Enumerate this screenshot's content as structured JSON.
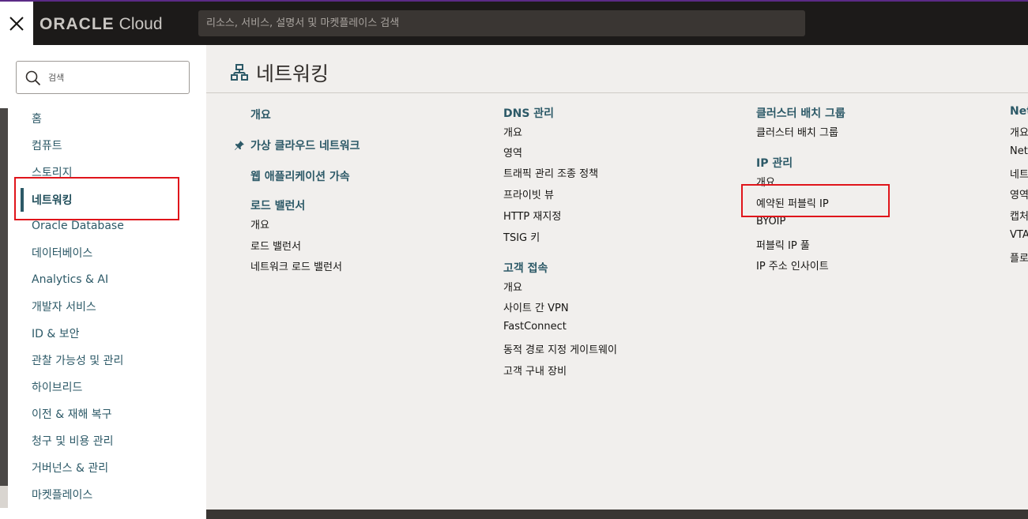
{
  "header": {
    "brand_oracle": "ORACLE",
    "brand_cloud": "Cloud",
    "search_placeholder": "리소스, 서비스, 설명서 및 마켓플레이스 검색"
  },
  "sidebar": {
    "search_placeholder": "검색",
    "items": [
      "홈",
      "컴퓨트",
      "스토리지",
      "네트워킹",
      "Oracle Database",
      "데이터베이스",
      "Analytics & AI",
      "개발자 서비스",
      "ID & 보안",
      "관찰 가능성 및 관리",
      "하이브리드",
      "이전 & 재해 복구",
      "청구 및 비용 관리",
      "거버넌스 & 관리",
      "마켓플레이스"
    ],
    "active_item": "네트워킹"
  },
  "main": {
    "title": "네트워킹",
    "col1": {
      "overview": "개요",
      "vcn": "가상 클라우드 네트워크",
      "waa": "웹 애플리케이션 가속",
      "lb_heading": "로드 밸런서",
      "lb_links": [
        "개요",
        "로드 밸런서",
        "네트워크 로드 밸런서"
      ]
    },
    "col2": {
      "dns_heading": "DNS 관리",
      "dns_links": [
        "개요",
        "영역",
        "트래픽 관리 조종 정책",
        "프라이빗 뷰",
        "HTTP 재지정",
        "TSIG 키"
      ],
      "cc_heading": "고객 접속",
      "cc_links": [
        "개요",
        "사이트 간 VPN",
        "FastConnect",
        "동적 경로 지정 게이트웨이",
        "고객 구내 장비"
      ]
    },
    "col3": {
      "cpg_heading": "클러스터 배치 그룹",
      "cpg_links": [
        "클러스터 배치 그룹"
      ],
      "ip_heading": "IP 관리",
      "ip_links": [
        "개요",
        "예약된 퍼블릭 IP",
        "BYOIP",
        "퍼블릭 IP 풀",
        "IP 주소 인사이트"
      ]
    },
    "col4": {
      "heading": "Net",
      "links": [
        "개요",
        "Netw",
        "네트",
        "영역",
        "캡처",
        "VTA",
        "플로"
      ]
    }
  }
}
